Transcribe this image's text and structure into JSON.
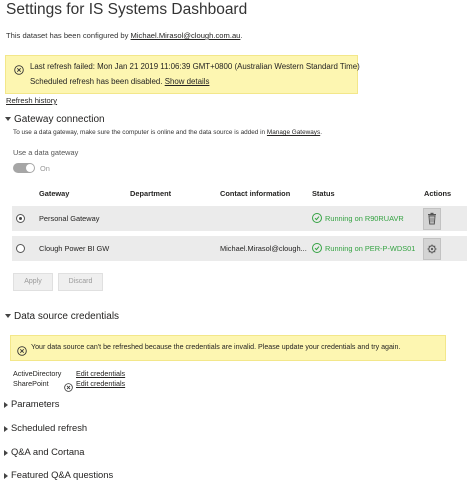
{
  "title": "Settings for IS Systems Dashboard",
  "configured": {
    "prefix": "This dataset has been configured by ",
    "email": "Michael.Mirasol@clough.com.au",
    "suffix": "."
  },
  "refresh_warning": {
    "line1": "Last refresh failed: Mon Jan 21 2019 11:06:39 GMT+0800 (Australian Western Standard Time)",
    "line2": "Scheduled refresh has been disabled.",
    "show_details": "Show details"
  },
  "refresh_history": "Refresh history",
  "gateway": {
    "heading": "Gateway connection",
    "description": "To use a data gateway, make sure the computer is online and the data source is added in",
    "manage_link": "Manage Gateways",
    "description_end": ".",
    "use_label": "Use a data gateway",
    "toggle_label": "On",
    "table": {
      "headers": {
        "gateway": "Gateway",
        "department": "Department",
        "contact": "Contact information",
        "status": "Status",
        "actions": "Actions"
      },
      "rows": [
        {
          "gateway": "Personal Gateway",
          "department": "",
          "contact": "",
          "status": "Running on R90RUAVR",
          "selected": true,
          "action_icon": "trash-icon"
        },
        {
          "gateway": "Clough Power BI GW",
          "department": "",
          "contact": "Michael.Mirasol@clough...",
          "status": "Running on PER-P-WDS01",
          "selected": false,
          "action_icon": "gear-icon"
        }
      ]
    },
    "apply_label": "Apply",
    "discard_label": "Discard"
  },
  "credentials": {
    "heading": "Data source credentials",
    "warning": "Your data source can't be refreshed because the credentials are invalid. Please update your credentials and try again.",
    "sources": [
      {
        "name": "ActiveDirectory",
        "link": "Edit credentials"
      },
      {
        "name": "SharePoint",
        "link": "Edit credentials"
      }
    ]
  },
  "collapsed_sections": [
    "Parameters",
    "Scheduled refresh",
    "Q&A and Cortana",
    "Featured Q&A questions"
  ],
  "colors": {
    "warning_bg": "#fdf6b1",
    "success": "#35a343",
    "row_bg": "#ebebeb"
  }
}
